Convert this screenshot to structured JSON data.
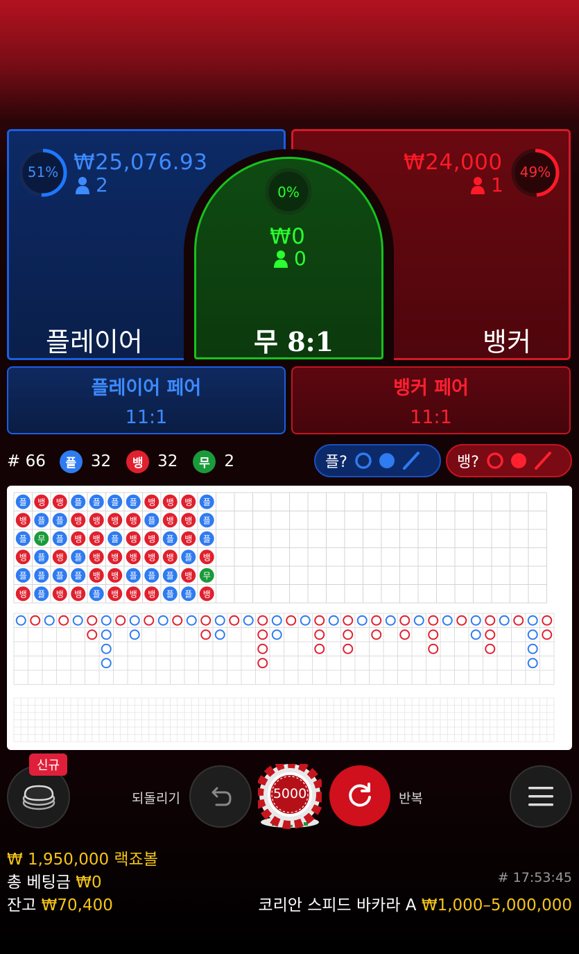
{
  "player": {
    "label": "플레이어",
    "percent": "51%",
    "percent_value": 0.51,
    "amount": "₩25,076.93",
    "count": "2",
    "color": "#1a5fe0"
  },
  "tie": {
    "label": "무 8:1",
    "percent": "0%",
    "percent_value": 0,
    "amount": "₩0",
    "count": "0",
    "color": "#18c21e"
  },
  "banker": {
    "label": "뱅커",
    "percent": "49%",
    "percent_value": 0.49,
    "amount": "₩24,000",
    "count": "1",
    "color": "#e0141e"
  },
  "pairs": {
    "player_pair": {
      "label": "플레이어 페어",
      "odds": "11:1"
    },
    "banker_pair": {
      "label": "뱅커 페어",
      "odds": "11:1"
    }
  },
  "stats": {
    "round": "# 66",
    "player_badge": "플",
    "player_count": "32",
    "banker_badge": "뱅",
    "banker_count": "32",
    "tie_badge": "무",
    "tie_count": "2"
  },
  "predict": {
    "player_label": "플?",
    "banker_label": "뱅?"
  },
  "bead_road": [
    [
      "플",
      "뱅",
      "플",
      "뱅",
      "플",
      "뱅"
    ],
    [
      "뱅",
      "플",
      "무",
      "플",
      "플",
      "플"
    ],
    [
      "뱅",
      "플",
      "플",
      "뱅",
      "플",
      "뱅"
    ],
    [
      "플",
      "뱅",
      "뱅",
      "플",
      "플",
      "뱅"
    ],
    [
      "플",
      "뱅",
      "뱅",
      "뱅",
      "뱅",
      "플"
    ],
    [
      "플",
      "뱅",
      "플",
      "뱅",
      "뱅",
      "뱅"
    ],
    [
      "플",
      "뱅",
      "뱅",
      "뱅",
      "플",
      "뱅"
    ],
    [
      "뱅",
      "플",
      "뱅",
      "뱅",
      "플",
      "뱅"
    ],
    [
      "뱅",
      "뱅",
      "플",
      "뱅",
      "플",
      "플"
    ],
    [
      "뱅",
      "뱅",
      "뱅",
      "플",
      "뱅",
      "플"
    ],
    [
      "플",
      "플",
      "플",
      "뱅",
      "무",
      "뱅"
    ]
  ],
  "controls": {
    "new_badge": "신규",
    "undo_label": "되돌리기",
    "chip_value": "5000",
    "repeat_label": "반복"
  },
  "footer": {
    "jackpot": "₩ 1,950,000 랙죠볼",
    "total_bet_label": "총 베팅금",
    "total_bet_value": "₩0",
    "balance_label": "잔고",
    "balance_value": "₩70,400",
    "game_id": "# 17:53:45",
    "table_name": "코리안 스피드 바카라 A",
    "limits": "₩1,000–5,000,000"
  },
  "colors": {
    "player_blue": "#2f7bf0",
    "banker_red": "#e0202e",
    "tie_green": "#1a9a3a",
    "gold": "#f5c518"
  }
}
